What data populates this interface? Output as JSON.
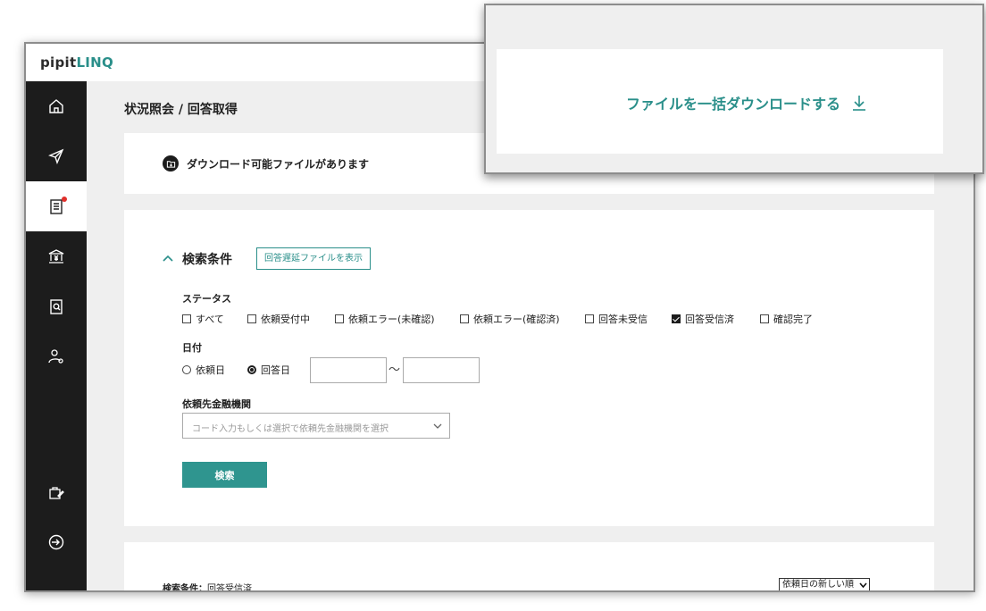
{
  "app": {
    "logo_prefix": "pipit",
    "logo_accent": "LINQ"
  },
  "colors": {
    "accent": "#2a8f8a",
    "sidebar": "#1c1c1c",
    "notification": "#e0302b"
  },
  "sidebar": {
    "items": [
      {
        "icon": "home-icon"
      },
      {
        "icon": "send-icon"
      },
      {
        "icon": "document-list-icon",
        "active": true,
        "notification": true
      },
      {
        "icon": "bank-icon"
      },
      {
        "icon": "document-search-icon"
      },
      {
        "icon": "user-settings-icon"
      },
      {
        "icon": "edit-bag-icon"
      },
      {
        "icon": "logout-icon"
      }
    ]
  },
  "page": {
    "title": "状況照会 / 回答取得"
  },
  "notice": {
    "text": "ダウンロード可能ファイルがあります",
    "icon": "download-folder-icon"
  },
  "callout": {
    "download_all_label": "ファイルを一括ダウンロードする",
    "icon": "download-arrow-icon"
  },
  "search": {
    "heading": "検索条件",
    "delay_button": "回答遅延ファイルを表示",
    "status_label": "ステータス",
    "statuses": [
      {
        "label": "すべて",
        "checked": false
      },
      {
        "label": "依頼受付中",
        "checked": false
      },
      {
        "label": "依頼エラー(未確認)",
        "checked": false
      },
      {
        "label": "依頼エラー(確認済)",
        "checked": false
      },
      {
        "label": "回答未受信",
        "checked": false
      },
      {
        "label": "回答受信済",
        "checked": true
      },
      {
        "label": "確認完了",
        "checked": false
      }
    ],
    "date_label": "日付",
    "date_options": [
      {
        "label": "依頼日",
        "selected": false
      },
      {
        "label": "回答日",
        "selected": true
      }
    ],
    "date_from": "",
    "date_to": "",
    "date_separator": "〜",
    "institution_label": "依頼先金融機関",
    "institution_placeholder": "コード入力もしくは選択で依頼先金融機関を選択",
    "submit_label": "検索"
  },
  "results": {
    "condition_prefix": "検索条件：",
    "condition_value": "回答受信済",
    "sort_selected": "依頼日の新しい順"
  }
}
